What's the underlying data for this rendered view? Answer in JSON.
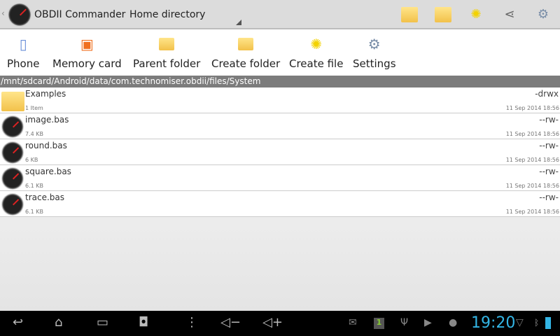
{
  "app": {
    "title": "OBDII Commander",
    "location": "Home directory"
  },
  "toolbar": [
    {
      "label": "Phone",
      "icon": "phone-icon"
    },
    {
      "label": "Memory card",
      "icon": "sd-card-icon"
    },
    {
      "label": "Parent folder",
      "icon": "parent-folder-icon"
    },
    {
      "label": "Create folder",
      "icon": "create-folder-icon"
    },
    {
      "label": "Create file",
      "icon": "create-file-icon"
    },
    {
      "label": "Settings",
      "icon": "settings-icon"
    }
  ],
  "path": "/mnt/sdcard/Android/data/com.technomiser.obdii/files/System",
  "files": [
    {
      "name": "Examples",
      "sub": "1 Item",
      "perm": "-drwx",
      "date": "11 Sep 2014 18:56",
      "type": "folder"
    },
    {
      "name": "image.bas",
      "sub": "7.4 KB",
      "perm": "--rw-",
      "date": "11 Sep 2014 18:56",
      "type": "file"
    },
    {
      "name": "round.bas",
      "sub": "6 KB",
      "perm": "--rw-",
      "date": "11 Sep 2014 18:56",
      "type": "file"
    },
    {
      "name": "square.bas",
      "sub": "6.1 KB",
      "perm": "--rw-",
      "date": "11 Sep 2014 18:56",
      "type": "file"
    },
    {
      "name": "trace.bas",
      "sub": "6.1 KB",
      "perm": "--rw-",
      "date": "11 Sep 2014 18:56",
      "type": "file"
    }
  ],
  "status": {
    "time": "19:20",
    "notification_count": "1"
  }
}
